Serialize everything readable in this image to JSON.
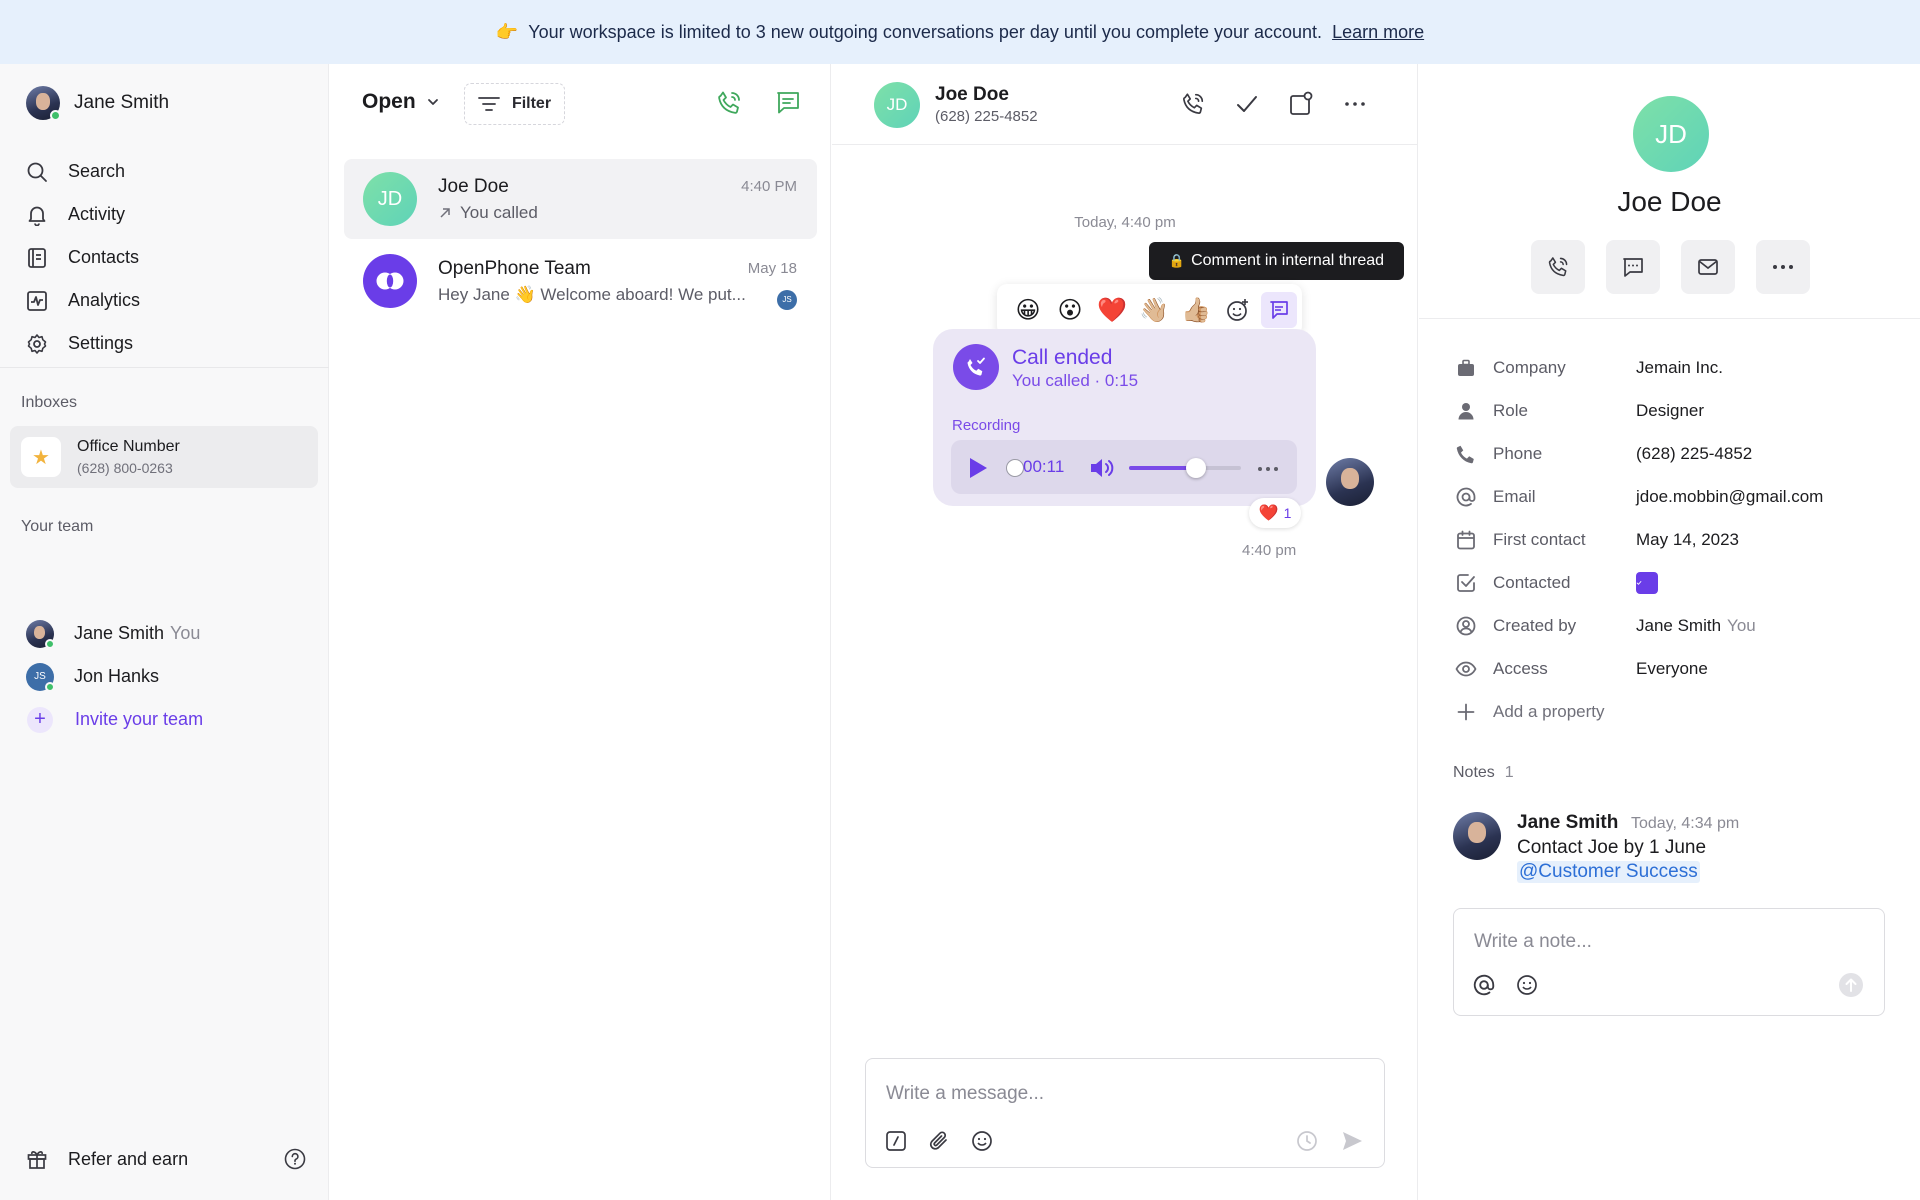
{
  "banner": {
    "emoji": "👉",
    "message": "Your workspace is limited to 3 new outgoing conversations per day until you complete your account.",
    "link_label": "Learn more"
  },
  "sidebar": {
    "user": {
      "name": "Jane Smith"
    },
    "nav": [
      {
        "label": "Search",
        "icon": "search-icon"
      },
      {
        "label": "Activity",
        "icon": "bell-icon"
      },
      {
        "label": "Contacts",
        "icon": "contacts-icon"
      },
      {
        "label": "Analytics",
        "icon": "analytics-icon"
      },
      {
        "label": "Settings",
        "icon": "gear-icon"
      }
    ],
    "inboxes_label": "Inboxes",
    "inbox": {
      "name": "Office Number",
      "number": "(628) 800-0263",
      "icon": "star-icon"
    },
    "team_label": "Your team",
    "team": [
      {
        "name": "Jane Smith",
        "suffix": "You"
      },
      {
        "name": "Jon Hanks",
        "initials": "JS"
      }
    ],
    "invite_label": "Invite your team",
    "refer_label": "Refer and earn"
  },
  "conversations": {
    "filter_status": "Open",
    "filter_label": "Filter",
    "items": [
      {
        "name": "Joe Doe",
        "initials": "JD",
        "preview": "You called",
        "time": "4:40 PM"
      },
      {
        "name": "OpenPhone Team",
        "preview": "Hey Jane 👋 Welcome aboard! We put...",
        "time": "May 18",
        "badge": "JS"
      }
    ]
  },
  "chat": {
    "contact_name": "Joe Doe",
    "contact_initials": "JD",
    "contact_phone": "(628) 225-4852",
    "date_separator": "Today, 4:40 pm",
    "tooltip": "Comment in internal thread",
    "reactions": [
      "😀",
      "😮",
      "❤️",
      "👋🏼",
      "👍🏼"
    ],
    "call": {
      "title": "Call ended",
      "subtitle": "You called · 0:15",
      "recording_label": "Recording",
      "player_time": "00:11",
      "volume_fraction": 0.6
    },
    "reaction_badge": {
      "emoji": "❤️",
      "count": "1"
    },
    "message_time": "4:40 pm",
    "composer_placeholder": "Write a message..."
  },
  "contact": {
    "initials": "JD",
    "name": "Joe Doe",
    "properties": [
      {
        "key": "Company",
        "value": "Jemain Inc.",
        "icon": "briefcase-icon"
      },
      {
        "key": "Role",
        "value": "Designer",
        "icon": "person-icon"
      },
      {
        "key": "Phone",
        "value": "(628) 225-4852",
        "icon": "phone-icon"
      },
      {
        "key": "Email",
        "value": "jdoe.mobbin@gmail.com",
        "icon": "at-icon"
      },
      {
        "key": "First contact",
        "value": "May 14, 2023",
        "icon": "calendar-icon"
      },
      {
        "key": "Contacted",
        "value_checked": true,
        "icon": "check-square-icon"
      },
      {
        "key": "Created by",
        "value": "Jane Smith",
        "value_suffix": "You",
        "icon": "user-circle-icon"
      },
      {
        "key": "Access",
        "value": "Everyone",
        "icon": "eye-icon"
      }
    ],
    "add_property_label": "Add a property",
    "notes_label": "Notes",
    "notes_count": "1",
    "note": {
      "author": "Jane Smith",
      "time": "Today, 4:34 pm",
      "text": "Contact Joe by 1 June",
      "mention": "@Customer Success"
    },
    "note_placeholder": "Write a note..."
  },
  "colors": {
    "accent": "#6a3de8",
    "green": "#3fbf6a",
    "banner_bg": "#e6f0fc"
  }
}
